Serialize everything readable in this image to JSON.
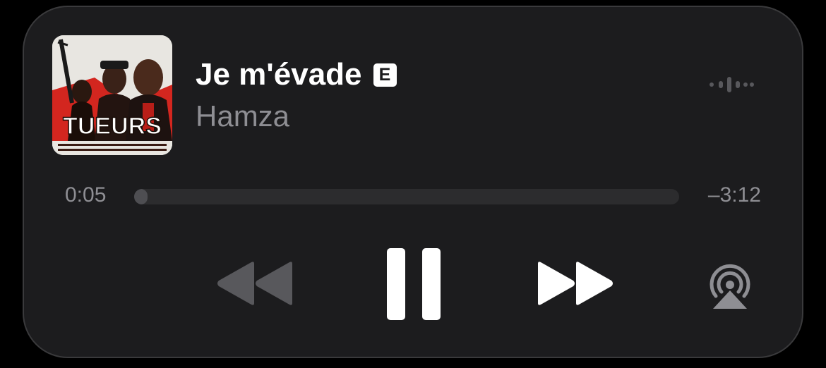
{
  "track": {
    "title": "Je m'évade",
    "explicit_badge": "E",
    "artist": "Hamza"
  },
  "artwork": {
    "headline": "TUEURS",
    "background": "#e8e6e1",
    "accent": "#d3261f"
  },
  "playback": {
    "elapsed": "0:05",
    "remaining": "–3:12",
    "progress": 0.025,
    "state": "playing"
  },
  "icons": {
    "waveform": "waveform-icon",
    "rewind": "backward-icon",
    "pause": "pause-icon",
    "forward": "forward-icon",
    "airplay": "airplay-audio-icon"
  },
  "colors": {
    "panel": "#1c1c1e",
    "primary_text": "#ffffff",
    "secondary_text": "#8e8e93",
    "disabled_control": "#58585c",
    "track": "#2c2c2e"
  }
}
